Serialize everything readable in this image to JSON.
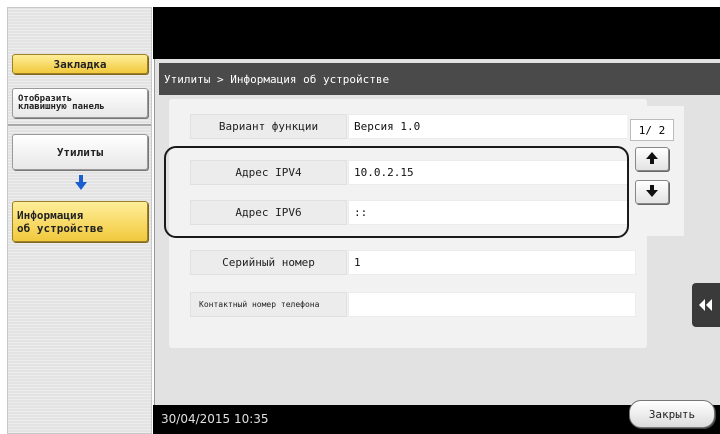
{
  "left_panel": {
    "bookmark_label": "Закладка",
    "show_keypad_line1": "Отобразить",
    "show_keypad_line2": "клавишную панель",
    "utilities_label": "Утилиты",
    "device_info_line1": "Информация",
    "device_info_line2": "об устройстве"
  },
  "main": {
    "breadcrumb": "Утилиты > Информация об устройстве",
    "rows": [
      {
        "label": "Вариант функции",
        "value": "Версия 1.0"
      },
      {
        "label": "Адрес IPV4",
        "value": "10.0.2.15"
      },
      {
        "label": "Адрес IPV6",
        "value": "::"
      },
      {
        "label": "Серийный номер",
        "value": "1"
      },
      {
        "label": "Контактный номер телефона",
        "value": ""
      }
    ],
    "page_indicator": "1/ 2"
  },
  "footer": {
    "datetime": "30/04/2015  10:35",
    "close_label": "Закрыть"
  },
  "icons": {
    "arrow_down": "arrow-down-icon",
    "page_up": "arrow-up-icon",
    "page_down": "arrow-down-icon",
    "side_tab": "double-chevron-left-icon"
  },
  "colors": {
    "accent_yellow": "#f1c93c",
    "arrow_blue": "#1b5fd1",
    "title_bar": "#4a4a4a"
  }
}
